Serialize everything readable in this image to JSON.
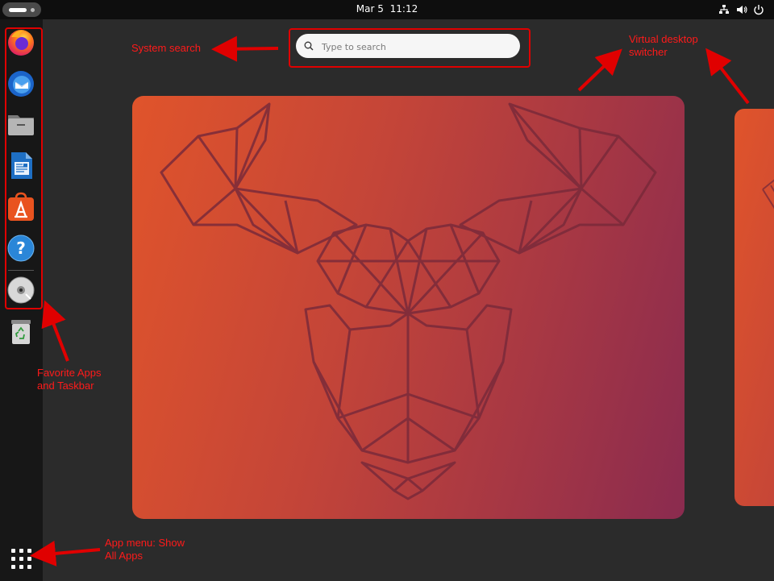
{
  "topbar": {
    "date": "Mar 5",
    "time": "11:12",
    "tray_icons": [
      "network-icon",
      "volume-icon",
      "power-icon"
    ]
  },
  "dock": {
    "favorites": [
      {
        "name": "firefox",
        "icon": "firefox-icon"
      },
      {
        "name": "thunderbird",
        "icon": "thunderbird-icon"
      },
      {
        "name": "files",
        "icon": "files-icon"
      },
      {
        "name": "libreoffice-writer",
        "icon": "writer-icon"
      },
      {
        "name": "app-center",
        "icon": "app-center-icon"
      },
      {
        "name": "help",
        "icon": "help-icon"
      },
      {
        "name": "disc",
        "icon": "disc-icon"
      },
      {
        "name": "trash",
        "icon": "trash-icon"
      }
    ],
    "show_apps_icon": "apps-grid-icon"
  },
  "search": {
    "placeholder": "Type to search"
  },
  "annotations": {
    "system_search": "System search",
    "virtual_desktop_line1": "Virtual desktop",
    "virtual_desktop_line2": "switcher",
    "favorites_line1": "Favorite Apps",
    "favorites_line2": "and Taskbar",
    "app_menu_line1": "App menu: Show",
    "app_menu_line2": "All Apps"
  },
  "colors": {
    "annotation": "#e00000",
    "wallpaper_orange": "#e0542b",
    "wallpaper_purple": "#8a2b4f"
  }
}
